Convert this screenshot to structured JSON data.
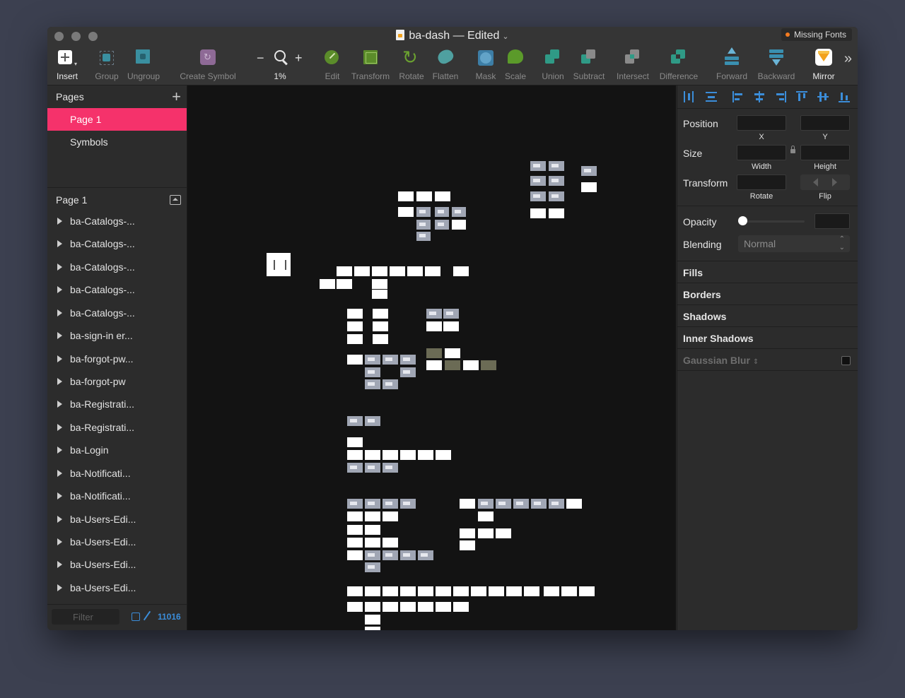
{
  "window": {
    "title": "ba-dash — Edited",
    "missing_fonts": "Missing Fonts",
    "accent_color": "#f5326b",
    "blue_color": "#3b8dd9"
  },
  "toolbar": {
    "insert": "Insert",
    "group": "Group",
    "ungroup": "Ungroup",
    "create_symbol": "Create Symbol",
    "zoom_minus": "−",
    "zoom_plus": "+",
    "zoom_level": "1%",
    "edit": "Edit",
    "transform": "Transform",
    "rotate": "Rotate",
    "flatten": "Flatten",
    "mask": "Mask",
    "scale": "Scale",
    "union": "Union",
    "subtract": "Subtract",
    "intersect": "Intersect",
    "difference": "Difference",
    "forward": "Forward",
    "backward": "Backward",
    "mirror": "Mirror",
    "more": "»"
  },
  "pages_panel": {
    "title": "Pages",
    "add": "+",
    "pages": [
      "Page 1",
      "Symbols"
    ],
    "selected": "Page 1"
  },
  "layers_panel": {
    "title": "Page 1",
    "layers": [
      "ba-Catalogs-...",
      "ba-Catalogs-...",
      "ba-Catalogs-...",
      "ba-Catalogs-...",
      "ba-Catalogs-...",
      "ba-sign-in er...",
      "ba-forgot-pw...",
      "ba-forgot-pw",
      "ba-Registrati...",
      "ba-Registrati...",
      "ba-Login",
      "ba-Notificati...",
      "ba-Notificati...",
      "ba-Users-Edi...",
      "ba-Users-Edi...",
      "ba-Users-Edi...",
      "ba-Users-Edi..."
    ],
    "filter_placeholder": "Filter",
    "count": "11016"
  },
  "inspector": {
    "position": "Position",
    "x": "X",
    "y": "Y",
    "size": "Size",
    "width": "Width",
    "height": "Height",
    "transform": "Transform",
    "rotate": "Rotate",
    "flip": "Flip",
    "opacity": "Opacity",
    "blending": "Blending",
    "blending_value": "Normal",
    "fills": "Fills",
    "borders": "Borders",
    "shadows": "Shadows",
    "inner_shadows": "Inner Shadows",
    "gaussian_blur": "Gaussian Blur"
  }
}
